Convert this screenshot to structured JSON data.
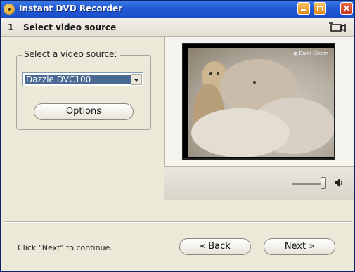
{
  "window": {
    "title": "Instant DVD Recorder"
  },
  "step": {
    "number": "1",
    "title": "Select video source"
  },
  "source": {
    "group_label": "Select a video source:",
    "selected": "Dazzle DVC100",
    "options_button": "Options"
  },
  "preview": {
    "channel_logo": "◉ Dizin Ülkem"
  },
  "footer": {
    "hint": "Click \"Next\" to continue.",
    "back_button": "« Back",
    "next_button": "Next »"
  },
  "colors": {
    "titlebar": "#2459d6",
    "window_bg": "#ece9d8",
    "selection": "#4a6a94"
  },
  "icons": [
    "app-icon",
    "minimize-icon",
    "maximize-icon",
    "close-icon",
    "camera-icon",
    "speaker-icon",
    "dropdown-arrow-icon"
  ]
}
